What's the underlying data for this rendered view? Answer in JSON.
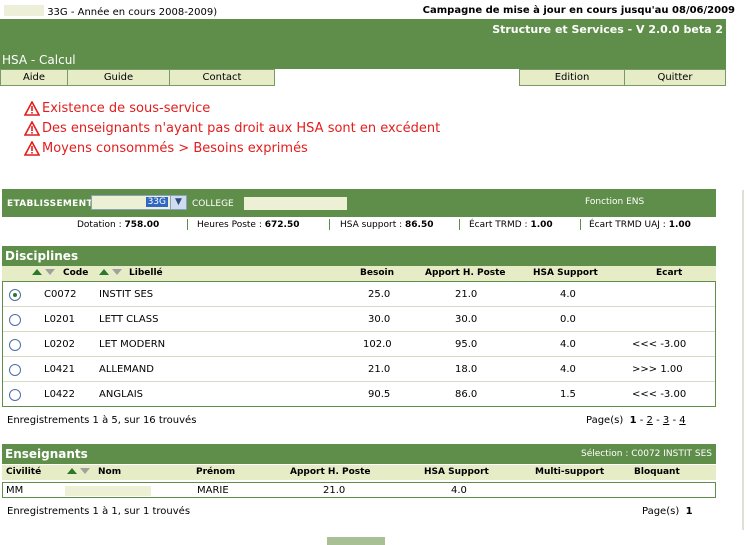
{
  "header": {
    "year_text": "33G - Année en cours 2008-2009)",
    "campaign": "Campagne de mise à jour en cours jusqu'au 08/06/2009",
    "version": "Structure et Services - V 2.0.0 beta 2",
    "app_title": "HSA - Calcul"
  },
  "menu": {
    "aide": "Aide",
    "guide": "Guide",
    "contact": "Contact",
    "edition": "Edition",
    "quitter": "Quitter"
  },
  "warnings": [
    "Existence de sous-service",
    "Des enseignants n'ayant pas droit aux HSA sont en excédent",
    "Moyens consommés > Besoins exprimés"
  ],
  "etablissement": {
    "label": "ETABLISSEMENT",
    "selected": "33G",
    "college_label": "COLLEGE",
    "fonction": "Fonction ENS"
  },
  "stats": {
    "dotation_label": "Dotation :",
    "dotation": "758.00",
    "heures_label": "Heures Poste :",
    "heures": "672.50",
    "hsa_label": "HSA support :",
    "hsa": "86.50",
    "trmd_label": "Écart TRMD :",
    "trmd": "1.00",
    "trmd_uaj_label": "Écart TRMD UAJ :",
    "trmd_uaj": "1.00"
  },
  "disciplines": {
    "title": "Disciplines",
    "columns": {
      "code": "Code",
      "libelle": "Libellé",
      "besoin": "Besoin",
      "apport": "Apport H. Poste",
      "hsa": "HSA Support",
      "ecart": "Ecart"
    },
    "rows": [
      {
        "code": "C0072",
        "libelle": "INSTIT SES",
        "besoin": "25.0",
        "apport": "21.0",
        "hsa": "4.0",
        "ecart": "",
        "selected": true
      },
      {
        "code": "L0201",
        "libelle": "LETT CLASS",
        "besoin": "30.0",
        "apport": "30.0",
        "hsa": "0.0",
        "ecart": "",
        "selected": false
      },
      {
        "code": "L0202",
        "libelle": "LET MODERN",
        "besoin": "102.0",
        "apport": "95.0",
        "hsa": "4.0",
        "ecart": "<<< -3.00",
        "selected": false
      },
      {
        "code": "L0421",
        "libelle": "ALLEMAND",
        "besoin": "21.0",
        "apport": "18.0",
        "hsa": "4.0",
        "ecart": ">>> 1.00",
        "selected": false
      },
      {
        "code": "L0422",
        "libelle": "ANGLAIS",
        "besoin": "90.5",
        "apport": "86.0",
        "hsa": "1.5",
        "ecart": "<<< -3.00",
        "selected": false
      }
    ],
    "records": "Enregistrements 1 à 5, sur 16 trouvés",
    "pages_label": "Page(s)",
    "pages": [
      "1",
      "2",
      "3",
      "4"
    ],
    "page_sep": "-"
  },
  "enseignants": {
    "title": "Enseignants",
    "selection": "Sélection : C0072 INSTIT SES",
    "columns": {
      "civilite": "Civilité",
      "nom": "Nom",
      "prenom": "Prénom",
      "apport": "Apport H. Poste",
      "hsa": "HSA Support",
      "multi": "Multi-support",
      "bloquant": "Bloquant"
    },
    "row": {
      "civilite": "MM",
      "prenom": "MARIE",
      "apport": "21.0",
      "hsa": "4.0"
    },
    "records": "Enregistrements 1 à 1, sur 1 trouvés",
    "pages_label": "Page(s)",
    "page": "1"
  },
  "colors": {
    "brand_green": "#5f8e4a",
    "light_green": "#e6ecc6",
    "warning_red": "#e31d1d"
  }
}
